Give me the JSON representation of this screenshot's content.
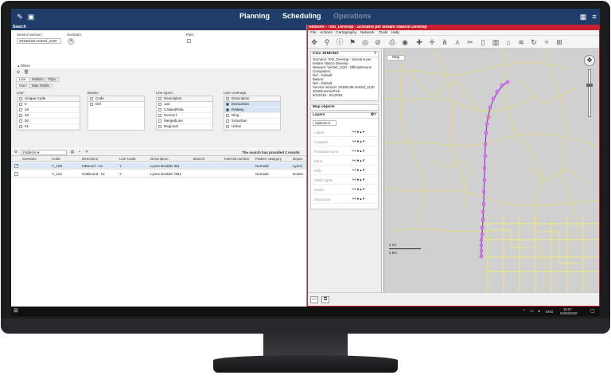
{
  "nav": {
    "planning": "Planning",
    "scheduling": "Scheduling",
    "operations": "Operations"
  },
  "search": {
    "title": "Search",
    "service_version_label": "Service version:",
    "service_version_value": "2018SUM-VerDef_1120",
    "scenario_label": "Scenario:",
    "plan_label": "Plan:",
    "filters_label": "Filters",
    "tabs": [
      "Line",
      "Pattern",
      "Trips"
    ],
    "subtabs": [
      "Main",
      "Max Fields"
    ],
    "line_label": "Line:",
    "line_header": "Unique Code",
    "line_items": [
      "0",
      "16",
      "48",
      "50",
      "51"
    ],
    "basins_label": "Basins:",
    "basins_header": "Code",
    "basins_items": [
      "Def"
    ],
    "line_types_label": "Line types:",
    "line_types_header": "Description",
    "line_types_items": [
      "122",
      "CaliandRida",
      "DemoLT",
      "MergedLine",
      "Regional"
    ],
    "line_coverage_label": "Line coverage:",
    "line_coverage_header": "Description",
    "line_coverage_items": [
      {
        "label": "Extraurban",
        "checked": true
      },
      {
        "label": "Railway",
        "checked": true
      },
      {
        "label": "Ring",
        "checked": false
      },
      {
        "label": "Suburban",
        "checked": false
      },
      {
        "label": "Urban",
        "checked": false
      }
    ]
  },
  "results": {
    "view_select": "Patterns",
    "status": "The search has provided 2 results",
    "columns": [
      "Scenario",
      "Code",
      "Directions",
      "Line Code",
      "Description",
      "Branch",
      "Internal number",
      "Pattern category",
      "Depar"
    ],
    "rows": [
      {
        "checked": true,
        "code": "Y_109",
        "direction": "InBound - As",
        "line": "Y",
        "description": "Lyons Boulder IB1",
        "category": "Normale",
        "depot": "Lyons"
      },
      {
        "checked": false,
        "code": "Y_110",
        "direction": "OutBound - Di",
        "line": "Y",
        "description": "Lyons Boulder OB1",
        "category": "Normale",
        "depot": "Downt"
      }
    ]
  },
  "network": {
    "title": "Network - Test_Develop - Scenario per testare rilascio Develop",
    "menu": [
      "File",
      "Actions",
      "Cartography",
      "Network",
      "Tools",
      "Help"
    ],
    "user": "Ciao JENKINS",
    "info_lines": [
      "Scenario: Test_Develop - Scenario per",
      "testare rilascio Develop",
      "Network: VerDef_1120 - OfficialVersion",
      "Companies:",
      "Def - Default",
      "Basins:",
      "Def - Default",
      "Service Version: 2018SUM-VerDef_1120",
      "2018SummerPick",
      "6/1/2018 - 9/1/2018"
    ],
    "map_objects_label": "Map objects",
    "layers_label": "Layers",
    "options_label": "Options",
    "layers": [
      "Labels",
      "Footpath",
      "Forbidden turns",
      "Parts",
      "Polly",
      "Traffic lights",
      "Switch",
      "Stop areas"
    ],
    "map_tab": "Map",
    "scale_top": "2 mi",
    "scale_bottom": "2 km"
  },
  "taskbar": {
    "lang": "ENG",
    "time": "16:57",
    "date": "04/03/2020"
  }
}
